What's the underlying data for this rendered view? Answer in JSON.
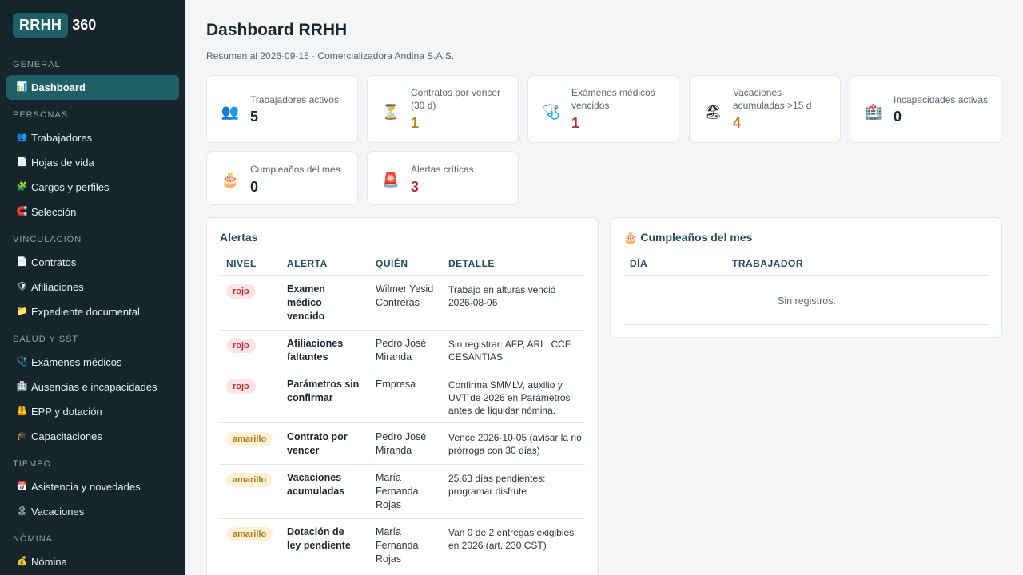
{
  "brand": {
    "box": "RRHH",
    "num": "360"
  },
  "sidebar": {
    "sections": [
      {
        "title": "GENERAL",
        "items": [
          {
            "icon": "📊",
            "label": "Dashboard",
            "active": true
          }
        ]
      },
      {
        "title": "PERSONAS",
        "items": [
          {
            "icon": "👥",
            "label": "Trabajadores"
          },
          {
            "icon": "📄",
            "label": "Hojas de vida"
          },
          {
            "icon": "🧩",
            "label": "Cargos y perfiles"
          },
          {
            "icon": "🧲",
            "label": "Selección"
          }
        ]
      },
      {
        "title": "VINCULACIÓN",
        "items": [
          {
            "icon": "📄",
            "label": "Contratos"
          },
          {
            "icon": "🛡",
            "label": "Afiliaciones"
          },
          {
            "icon": "📁",
            "label": "Expediente documental"
          }
        ]
      },
      {
        "title": "SALUD Y SST",
        "items": [
          {
            "icon": "🩺",
            "label": "Exámenes médicos"
          },
          {
            "icon": "🏥",
            "label": "Ausencias e incapacidades"
          },
          {
            "icon": "🦺",
            "label": "EPP y dotación"
          },
          {
            "icon": "🎓",
            "label": "Capacitaciones"
          }
        ]
      },
      {
        "title": "TIEMPO",
        "items": [
          {
            "icon": "📅",
            "label": "Asistencia y novedades"
          },
          {
            "icon": "🏝",
            "label": "Vacaciones"
          }
        ]
      },
      {
        "title": "NÓMINA",
        "items": [
          {
            "icon": "💰",
            "label": "Nómina"
          }
        ]
      }
    ]
  },
  "header": {
    "title": "Dashboard RRHH",
    "subtitle": "Resumen al 2026-09-15 · Comercializadora Andina S.A.S."
  },
  "kpis": [
    {
      "icon": "👥",
      "label": "Trabajadores activos",
      "value": "5",
      "color": "#1a2630"
    },
    {
      "icon": "⏳",
      "label": "Contratos por vencer (30 d)",
      "value": "1",
      "color": "#c47f12"
    },
    {
      "icon": "🩺",
      "label": "Exámenes médicos vencidos",
      "value": "1",
      "color": "#b83232"
    },
    {
      "icon": "🏖",
      "label": "Vacaciones acumuladas >15 d",
      "value": "4",
      "color": "#c47f12"
    },
    {
      "icon": "🏥",
      "label": "Incapacidades activas",
      "value": "0",
      "color": "#1a2630"
    },
    {
      "icon": "🎂",
      "label": "Cumpleaños del mes",
      "value": "0",
      "color": "#1a2630"
    },
    {
      "icon": "🚨",
      "label": "Alertas críticas",
      "value": "3",
      "color": "#b83232"
    }
  ],
  "alerts": {
    "title": "Alertas",
    "columns": [
      "NIVEL",
      "ALERTA",
      "QUIÉN",
      "DETALLE"
    ],
    "rows": [
      {
        "level": "rojo",
        "alert": "Examen\nmédico\nvencido",
        "who": "Wilmer Yesid\nContreras",
        "detail": "Trabajo en alturas venció\n2026-08-06"
      },
      {
        "level": "rojo",
        "alert": "Afiliaciones\nfaltantes",
        "who": "Pedro José\nMiranda",
        "detail": "Sin registrar: AFP, ARL, CCF,\nCESANTIAS"
      },
      {
        "level": "rojo",
        "alert": "Parámetros sin\nconfirmar",
        "who": "Empresa",
        "detail": "Confirma SMMLV, auxilio y\nUVT de 2026 en Parámetros\nantes de liquidar nómina."
      },
      {
        "level": "amarillo",
        "alert": "Contrato por\nvencer",
        "who": "Pedro José\nMiranda",
        "detail": "Vence 2026-10-05 (avisar la no\nprórroga con 30 días)"
      },
      {
        "level": "amarillo",
        "alert": "Vacaciones\nacumuladas",
        "who": "María\nFernanda\nRojas",
        "detail": "25.63 días pendientes:\nprogramar disfrute"
      },
      {
        "level": "amarillo",
        "alert": "Dotación de\nley pendiente",
        "who": "María\nFernanda\nRojas",
        "detail": "Van 0 de 2 entregas exigibles\nen 2026 (art. 230 CST)"
      }
    ]
  },
  "birthdays": {
    "icon": "🎂",
    "title": "Cumpleaños del mes",
    "columns": [
      "DÍA",
      "TRABAJADOR"
    ],
    "empty": "Sin registros."
  }
}
